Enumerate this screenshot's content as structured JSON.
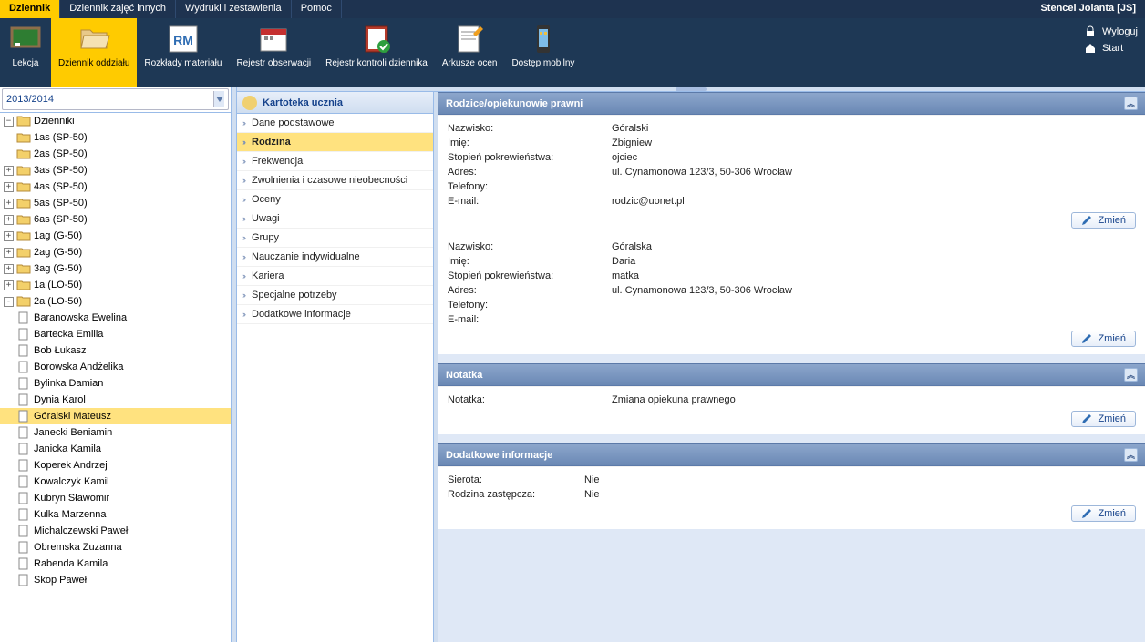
{
  "menubar": {
    "items": [
      "Dziennik",
      "Dziennik zajęć innych",
      "Wydruki i zestawienia",
      "Pomoc"
    ],
    "active_index": 0,
    "user": "Stencel Jolanta [JS]"
  },
  "ribbon": {
    "buttons": [
      {
        "label": "Lekcja"
      },
      {
        "label": "Dziennik oddziału"
      },
      {
        "label": "Rozkłady materiału"
      },
      {
        "label": "Rejestr obserwacji"
      },
      {
        "label": "Rejestr kontroli dziennika"
      },
      {
        "label": "Arkusze ocen"
      },
      {
        "label": "Dostęp mobilny"
      }
    ],
    "active_index": 1,
    "logout": "Wyloguj",
    "start": "Start"
  },
  "schoolyear": "2013/2014",
  "tree": {
    "root": "Dzienniki",
    "classes": [
      {
        "label": "1as (SP-50)",
        "expander": ""
      },
      {
        "label": "2as (SP-50)",
        "expander": ""
      },
      {
        "label": "3as (SP-50)",
        "expander": "+"
      },
      {
        "label": "4as (SP-50)",
        "expander": "+"
      },
      {
        "label": "5as (SP-50)",
        "expander": "+"
      },
      {
        "label": "6as (SP-50)",
        "expander": "+"
      },
      {
        "label": "1ag (G-50)",
        "expander": "+"
      },
      {
        "label": "2ag (G-50)",
        "expander": "+"
      },
      {
        "label": "3ag (G-50)",
        "expander": "+"
      },
      {
        "label": "1a (LO-50)",
        "expander": "+"
      },
      {
        "label": "2a (LO-50)",
        "expander": "-",
        "open": true
      }
    ],
    "students": [
      "Baranowska Ewelina",
      "Bartecka Emilia",
      "Bob Łukasz",
      "Borowska Andżelika",
      "Bylinka Damian",
      "Dynia Karol",
      "Góralski Mateusz",
      "Janecki Beniamin",
      "Janicka Kamila",
      "Koperek Andrzej",
      "Kowalczyk Kamil",
      "Kubryn Sławomir",
      "Kulka Marzenna",
      "Michalczewski Paweł",
      "Obremska Zuzanna",
      "Rabenda Kamila",
      "Skop Paweł"
    ],
    "selected_student_index": 6
  },
  "kartoteka": {
    "title": "Kartoteka ucznia",
    "items": [
      "Dane podstawowe",
      "Rodzina",
      "Frekwencja",
      "Zwolnienia i czasowe nieobecności",
      "Oceny",
      "Uwagi",
      "Grupy",
      "Nauczanie indywidualne",
      "Kariera",
      "Specjalne potrzeby",
      "Dodatkowe informacje"
    ],
    "selected_index": 1
  },
  "buttons": {
    "change": "Zmień"
  },
  "sections": {
    "parents": {
      "title": "Rodzice/opiekunowie prawni",
      "labels": {
        "surname": "Nazwisko:",
        "firstname": "Imię:",
        "relation": "Stopień pokrewieństwa:",
        "address": "Adres:",
        "phones": "Telefony:",
        "email": "E-mail:"
      },
      "records": [
        {
          "surname": "Góralski",
          "firstname": "Zbigniew",
          "relation": "ojciec",
          "address": "ul. Cynamonowa 123/3, 50-306 Wrocław",
          "phones": "",
          "email": "rodzic@uonet.pl"
        },
        {
          "surname": "Góralska",
          "firstname": "Daria",
          "relation": "matka",
          "address": "ul. Cynamonowa 123/3, 50-306 Wrocław",
          "phones": "",
          "email": ""
        }
      ]
    },
    "note": {
      "title": "Notatka",
      "label": "Notatka:",
      "value": "Zmiana opiekuna prawnego"
    },
    "extra": {
      "title": "Dodatkowe informacje",
      "rows": [
        {
          "label": "Sierota:",
          "value": "Nie"
        },
        {
          "label": "Rodzina zastępcza:",
          "value": "Nie"
        }
      ]
    }
  }
}
